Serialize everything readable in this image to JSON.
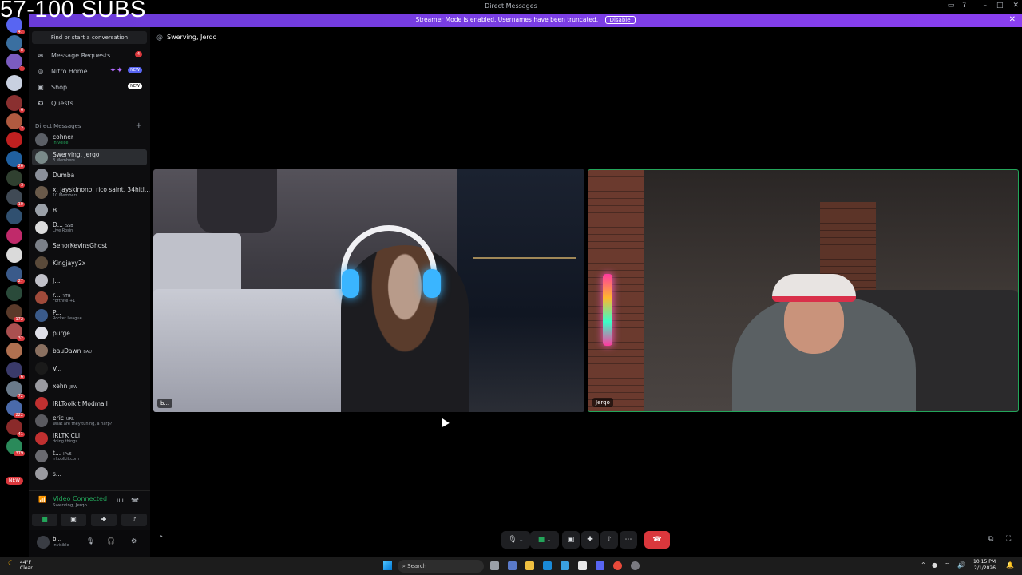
{
  "overlay": {
    "subs_goal": "57-100 SUBS"
  },
  "window": {
    "title": "Direct Messages"
  },
  "banner": {
    "message": "Streamer Mode is enabled. Usernames have been truncated.",
    "disable_label": "Disable"
  },
  "sidebar": {
    "search_placeholder": "Find or start a conversation",
    "nav": [
      {
        "label": "Message Requests",
        "badge": "4"
      },
      {
        "label": "Nitro Home",
        "badge": "NEW"
      },
      {
        "label": "Shop",
        "badge": "NEW"
      },
      {
        "label": "Quests"
      }
    ],
    "dm_header": "Direct Messages",
    "dms": [
      {
        "name": "cohner",
        "sub": "In voice"
      },
      {
        "name": "Swerving, Jerqo",
        "sub": "3 Members"
      },
      {
        "name": "Dumba",
        "sub": ""
      },
      {
        "name": "x, jayskinono, rico saint, 34hitl...",
        "sub": "10 Members"
      },
      {
        "name": "B...",
        "sub": ""
      },
      {
        "name": "D...",
        "tag": "SSB",
        "sub": "Live Rosin"
      },
      {
        "name": "SenorKevinsGhost",
        "sub": ""
      },
      {
        "name": "Kingjayy2x",
        "sub": ""
      },
      {
        "name": "J...",
        "sub": ""
      },
      {
        "name": "r...",
        "tag": "YTG",
        "sub": "Fortnite +1"
      },
      {
        "name": "P...",
        "sub": "Rocket League"
      },
      {
        "name": "purge",
        "sub": ""
      },
      {
        "name": "bauDawn",
        "tag": "BAU",
        "sub": ""
      },
      {
        "name": "V...",
        "sub": ""
      },
      {
        "name": "xehn",
        "tag": "JEW",
        "sub": ""
      },
      {
        "name": "IRLToolkit Modmail",
        "sub": ""
      },
      {
        "name": "eric",
        "tag": "URL",
        "sub": "what are they tuning, a harp?"
      },
      {
        "name": "IRLTK CLI",
        "sub": "doing things"
      },
      {
        "name": "t...",
        "tag": "IPv6",
        "sub": "irltoolkit.com"
      },
      {
        "name": "s...",
        "sub": ""
      }
    ]
  },
  "voice": {
    "status": "Video Connected",
    "channel": "Swerving, Jerqo"
  },
  "user": {
    "name": "b...",
    "status": "Invisible"
  },
  "call": {
    "header": "Swerving, Jerqo",
    "tiles": [
      {
        "label": "b..."
      },
      {
        "label": "Jerqo"
      }
    ]
  },
  "taskbar": {
    "temp": "44°F",
    "weather": "Clear",
    "search_placeholder": "Search",
    "time": "10:15 PM",
    "date": "2/1/2026"
  },
  "colors": {
    "accent": "#5865f2",
    "green": "#23a55a",
    "red": "#da373c",
    "banner": "#7a3de6"
  },
  "server_badges": [
    "47",
    "8",
    "1",
    "6",
    "2",
    "26",
    "3",
    "10",
    "27",
    "172",
    "32",
    "6",
    "72",
    "222",
    "41",
    "379"
  ]
}
